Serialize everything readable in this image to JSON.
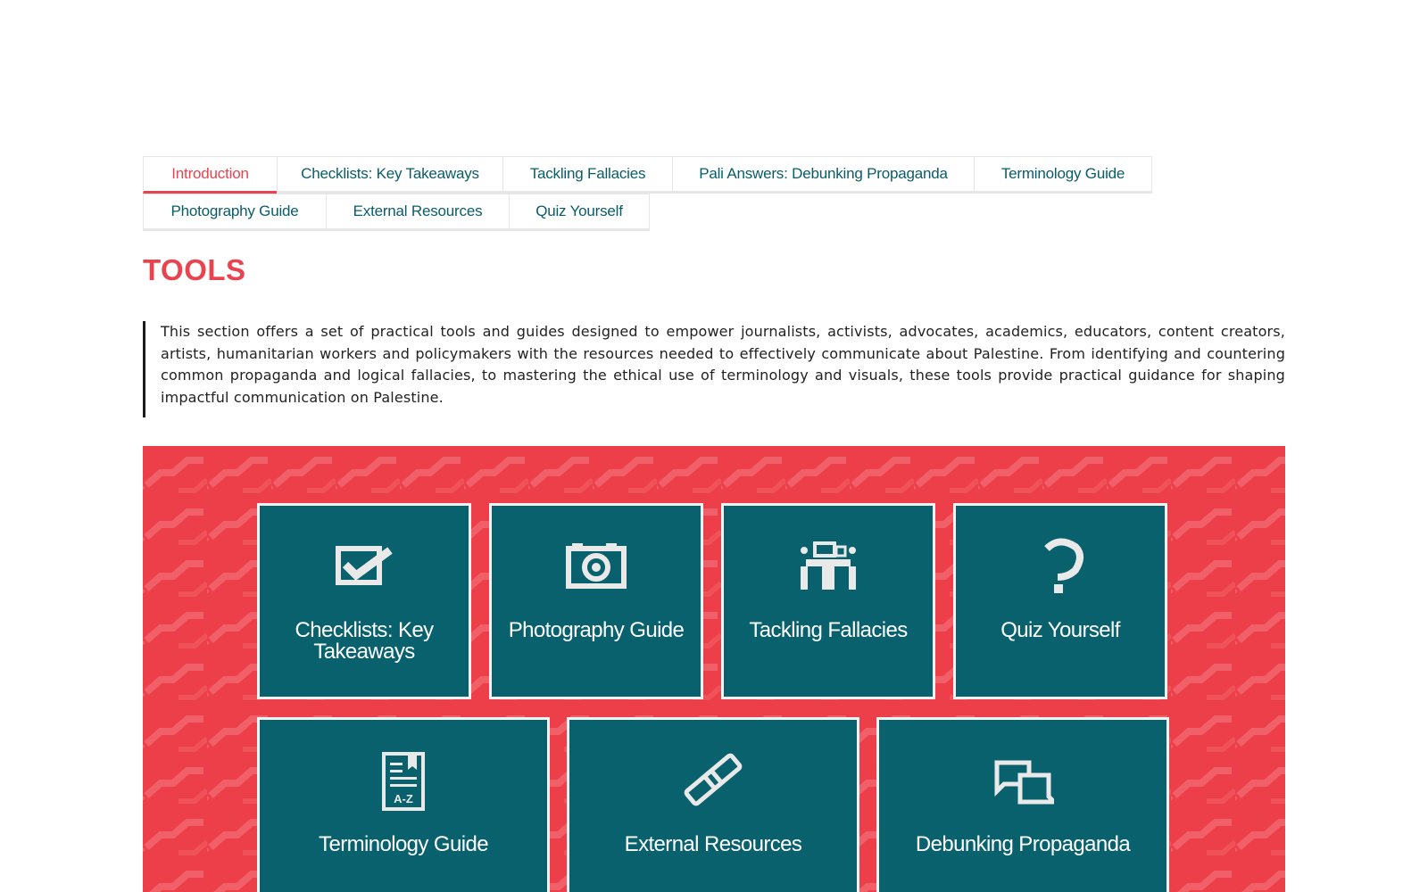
{
  "tabs": {
    "row1": [
      {
        "label": "Introduction",
        "active": true
      },
      {
        "label": "Checklists: Key Takeaways",
        "active": false
      },
      {
        "label": "Tackling Fallacies",
        "active": false
      },
      {
        "label": "Pali Answers: Debunking Propaganda",
        "active": false
      },
      {
        "label": "Terminology Guide",
        "active": false
      }
    ],
    "row2": [
      {
        "label": "Photography Guide",
        "active": false
      },
      {
        "label": "External Resources",
        "active": false
      },
      {
        "label": "Quiz Yourself",
        "active": false
      }
    ]
  },
  "section": {
    "title": "TOOLS",
    "intro": "This section offers a set of practical tools and guides designed to empower journalists, activists, advocates, academics, educators, content creators, artists, humanitarian workers and policymakers with the resources needed to effectively communicate about Palestine. From identifying and countering common propaganda and logical fallacies, to mastering the ethical use of terminology and visuals, these tools provide practical guidance for shaping impactful communication on Palestine."
  },
  "tiles": [
    {
      "label": "Checklists: Key Takeaways",
      "icon": "checklist-icon"
    },
    {
      "label": "Photography Guide",
      "icon": "camera-icon"
    },
    {
      "label": "Tackling Fallacies",
      "icon": "podium-icon"
    },
    {
      "label": "Quiz Yourself",
      "icon": "question-mark-icon"
    },
    {
      "label": "Terminology Guide",
      "icon": "glossary-a-z-icon"
    },
    {
      "label": "External Resources",
      "icon": "link-icon"
    },
    {
      "label": "Debunking Propaganda",
      "icon": "chat-bubbles-icon"
    }
  ],
  "colors": {
    "accent_red": "#e8434e",
    "panel_red": "#ec3f4a",
    "tile_teal": "#08616d",
    "tab_text_teal": "#0a5c68",
    "body_text": "#222222"
  }
}
